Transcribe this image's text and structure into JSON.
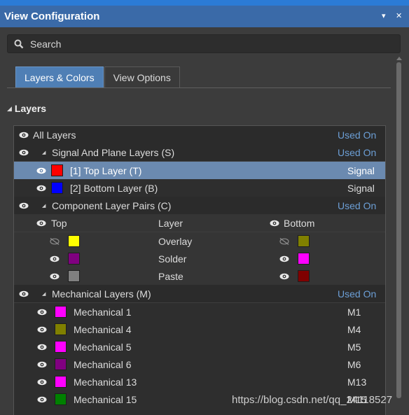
{
  "window": {
    "title": "View Configuration",
    "pin_glyph": "▾",
    "close_glyph": "✕"
  },
  "search": {
    "placeholder": "Search",
    "icon": "search-icon"
  },
  "tabs": [
    {
      "label": "Layers & Colors",
      "active": true
    },
    {
      "label": "View Options",
      "active": false
    }
  ],
  "section": {
    "label": "Layers",
    "caret": "◢"
  },
  "layers": {
    "all": {
      "label": "All Layers",
      "right": "Used On"
    },
    "signal_group": {
      "label": "Signal And Plane Layers (S)",
      "right": "Used On"
    },
    "signal_layers": [
      {
        "label": "[1] Top Layer (T)",
        "color": "#ff0000",
        "right": "Signal",
        "selected": true
      },
      {
        "label": "[2] Bottom Layer (B)",
        "color": "#0000ff",
        "right": "Signal",
        "selected": false
      }
    ],
    "component_group": {
      "label": "Component Layer Pairs (C)",
      "right": "Used On"
    },
    "component_header": {
      "top": "Top",
      "layer": "Layer",
      "bottom": "Bottom"
    },
    "component_pairs": [
      {
        "name": "Overlay",
        "top_color": "#ffff00",
        "bottom_color": "#808000",
        "top_visible": false,
        "bottom_visible": false
      },
      {
        "name": "Solder",
        "top_color": "#800080",
        "bottom_color": "#ff00ff",
        "top_visible": true,
        "bottom_visible": true
      },
      {
        "name": "Paste",
        "top_color": "#808080",
        "bottom_color": "#800000",
        "top_visible": true,
        "bottom_visible": true
      }
    ],
    "mechanical_group": {
      "label": "Mechanical Layers (M)",
      "right": "Used On"
    },
    "mechanical_layers": [
      {
        "label": "Mechanical 1",
        "color": "#ff00ff",
        "right": "M1"
      },
      {
        "label": "Mechanical 4",
        "color": "#808000",
        "right": "M4"
      },
      {
        "label": "Mechanical 5",
        "color": "#ff00ff",
        "right": "M5"
      },
      {
        "label": "Mechanical 6",
        "color": "#800080",
        "right": "M6"
      },
      {
        "label": "Mechanical 13",
        "color": "#ff00ff",
        "right": "M13"
      },
      {
        "label": "Mechanical 15",
        "color": "#008000",
        "right": "M15"
      }
    ]
  },
  "colors": {
    "accent": "#3a6aa8",
    "used_on": "#6c9fd6",
    "selected_row": "#6b8ab0"
  },
  "watermark": "https://blog.csdn.net/qq_24118527"
}
